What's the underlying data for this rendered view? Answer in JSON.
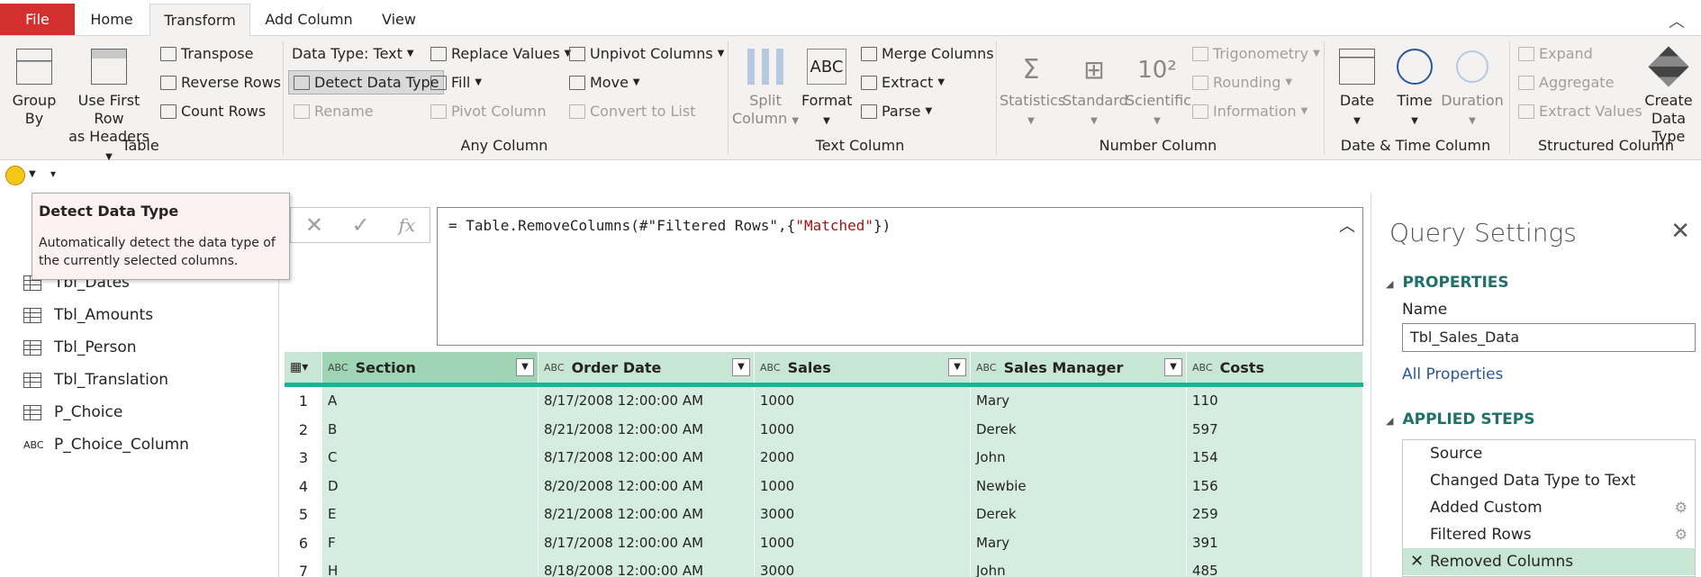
{
  "tabs": [
    "File",
    "Home",
    "Transform",
    "Add Column",
    "View"
  ],
  "ribbon": {
    "table": {
      "group_by": "Group\nBy",
      "use_first_row": "Use First Row",
      "as_headers": "as Headers",
      "transpose": "Transpose",
      "reverse_rows": "Reverse Rows",
      "count_rows": "Count Rows",
      "label": "Table"
    },
    "any": {
      "data_type": "Data Type: Text",
      "detect": "Detect Data Type",
      "rename": "Rename",
      "replace": "Replace Values",
      "fill": "Fill",
      "pivot": "Pivot Column",
      "unpivot": "Unpivot Columns",
      "move": "Move",
      "convert": "Convert to List",
      "label": "Any Column"
    },
    "text": {
      "split": "Split",
      "split2": "Column",
      "format": "Format",
      "merge": "Merge Columns",
      "extract": "Extract",
      "parse": "Parse",
      "label": "Text Column"
    },
    "number": {
      "statistics": "Statistics",
      "standard": "Standard",
      "scientific": "Scientific",
      "trig": "Trigonometry",
      "rounding": "Rounding",
      "information": "Information",
      "label": "Number Column"
    },
    "datetime": {
      "date": "Date",
      "time": "Time",
      "duration": "Duration",
      "label": "Date & Time Column"
    },
    "structured": {
      "expand": "Expand",
      "aggregate": "Aggregate",
      "extract_values": "Extract Values",
      "create": "Create",
      "data_type": "Data Type",
      "label": "Structured Column"
    }
  },
  "tooltip": {
    "title": "Detect Data Type",
    "desc": "Automatically detect the data type of the currently selected columns."
  },
  "queries": [
    {
      "name": "Tbl_Dates",
      "icon": "table-icon"
    },
    {
      "name": "Tbl_Amounts",
      "icon": "table-icon"
    },
    {
      "name": "Tbl_Person",
      "icon": "table-icon"
    },
    {
      "name": "Tbl_Translation",
      "icon": "table-icon"
    },
    {
      "name": "P_Choice",
      "icon": "table-icon"
    },
    {
      "name": "P_Choice_Column",
      "icon": "text-type-icon"
    }
  ],
  "formula": {
    "prefix": "= Table.RemoveColumns(#\"Filtered Rows\",{",
    "string": "\"Matched\"",
    "suffix": "})"
  },
  "grid": {
    "columns": [
      "Section",
      "Order Date",
      "Sales",
      "Sales Manager",
      "Costs"
    ],
    "rows": [
      [
        "1",
        "A",
        "8/17/2008 12:00:00 AM",
        "1000",
        "Mary",
        "110"
      ],
      [
        "2",
        "B",
        "8/21/2008 12:00:00 AM",
        "1000",
        "Derek",
        "597"
      ],
      [
        "3",
        "C",
        "8/17/2008 12:00:00 AM",
        "2000",
        "John",
        "154"
      ],
      [
        "4",
        "D",
        "8/20/2008 12:00:00 AM",
        "1000",
        "Newbie",
        "156"
      ],
      [
        "5",
        "E",
        "8/21/2008 12:00:00 AM",
        "3000",
        "Derek",
        "259"
      ],
      [
        "6",
        "F",
        "8/17/2008 12:00:00 AM",
        "1000",
        "Mary",
        "391"
      ],
      [
        "7",
        "H",
        "8/18/2008 12:00:00 AM",
        "3000",
        "John",
        "485"
      ]
    ]
  },
  "settings": {
    "title": "Query Settings",
    "properties": "PROPERTIES",
    "name_label": "Name",
    "name_value": "Tbl_Sales_Data",
    "all_properties": "All Properties",
    "applied_steps": "APPLIED STEPS",
    "steps": [
      "Source",
      "Changed Data Type to Text",
      "Added Custom",
      "Filtered Rows",
      "Removed Columns"
    ]
  }
}
